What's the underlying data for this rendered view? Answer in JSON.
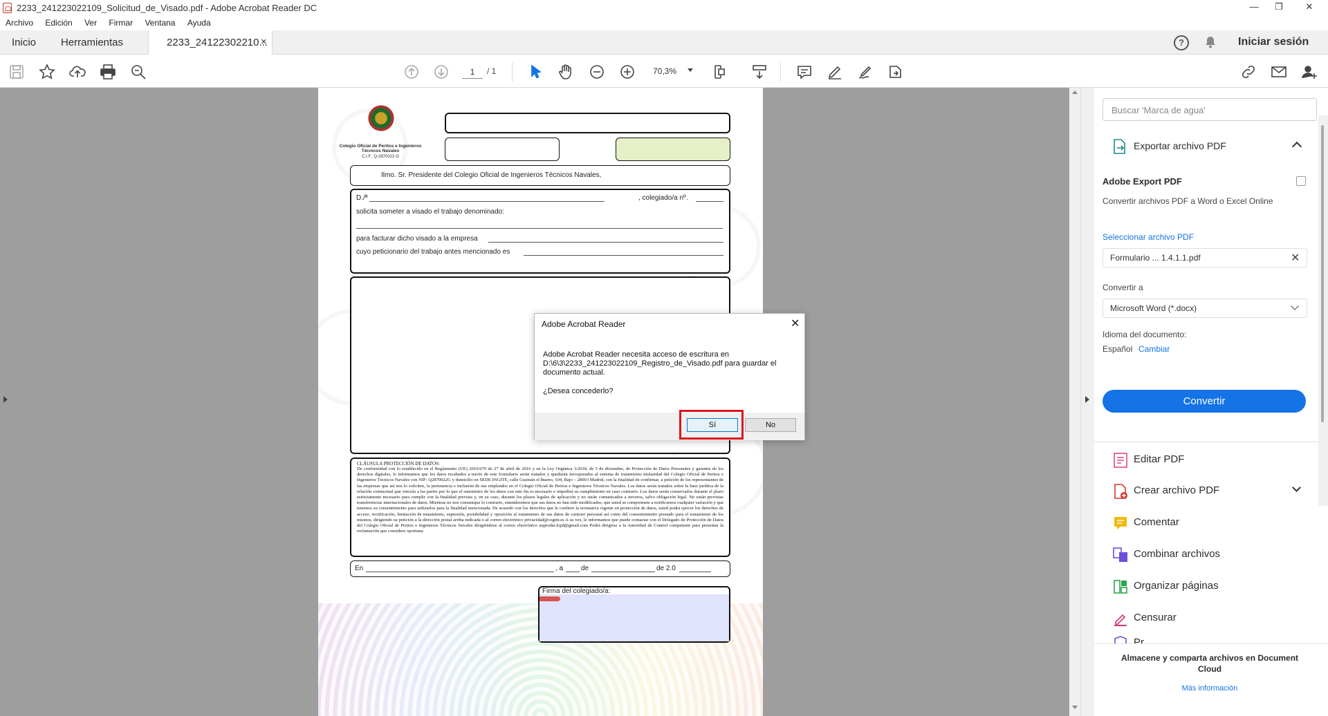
{
  "window": {
    "title": "2233_241223022109_Solicitud_de_Visado.pdf - Adobe Acrobat Reader DC",
    "controls": [
      "—",
      "❐",
      "✕"
    ]
  },
  "menu": [
    "Archivo",
    "Edición",
    "Ver",
    "Firmar",
    "Ventana",
    "Ayuda"
  ],
  "tabs": {
    "home": "Inicio",
    "tools": "Herramientas",
    "doc": "2233_24122302210...",
    "doc_close": "×",
    "signin": "Iniciar sesión"
  },
  "toolbar": {
    "page_current": "1",
    "page_total": "/ 1",
    "zoom": "70,3%"
  },
  "form": {
    "org_name": "Colegio Oficial de Peritos e Ingenieros Técnicos Navales",
    "cif": "C.I.F.: Q-2870022-G",
    "addressee": "Ilmo. Sr. Presidente del Colegio Oficial de Ingenieros Técnicos Navales,",
    "line1_a": "D./ª",
    "line1_b": ", colegiado/a nº.",
    "line2": "solicita someter a visado el trabajo denominado:",
    "line4": "para facturar dicho visado a la empresa",
    "line5": "cuyo peticionario del trabajo antes mencionado es",
    "legal_title": "CLÁUSULA PROTECCIÓN DE DATOS:",
    "legal_text": "De conformidad con lo establecido en el Reglamento (UE) 2016/679 de 27 de abril de 2016 y en la Ley Orgánica 3/2018, de 5 de diciembre, de Protección de Datos Personales y garantía de los derechos digitales, le informamos que los datos recabados a través de este formulario serán tratados y quedarán incorporados al sistema de tratamiento titularidad del Colegio Oficial de Peritos e Ingenieros Técnicos Navales con NIF: Q2870022G y domicilio en SEDE INGITE, calle Guzmán el Bueno, 104, Bajo – 28003 Madrid, con la finalidad de confirmar, a petición de los representantes de las empresas que así nos lo soliciten, la pertenencia e inclusión de sus empleados en el Colegio Oficial de Peritos e Ingenieros Técnicos Navales. Los datos serán tratados sobre la base jurídica de la relación contractual que vincula a las partes por lo que el suministro de los datos con este fin es necesario e impedirá su cumplimiento en caso contrario. Los datos serán conservados durante el plazo estrictamente necesario para cumplir con la finalidad prevista y, en su caso, durante los plazos legales de aplicación y no serán comunicados a terceros, salvo obligación legal. No están previstas transferencias internacionales de datos. Mientras no nos comunique lo contrario, entenderemos que sus datos no han sido modificados, que usted se compromete a notificarnos cualquier variación y que tenemos su consentimiento para utilizarlos para la finalidad mencionada. De acuerdo con los derechos que le confiere la normativa vigente en protección de datos, usted podrá ejercer los derechos de acceso, rectificación, limitación de tratamiento, supresión, portabilidad y oposición al tratamiento de sus datos de carácter personal así como del consentimiento prestado para el tratamiento de los mismos, dirigiendo su petición a la dirección postal arriba indicada o al correo electrónico privacidad@cogitn.es A su vez, le informamos que puede contactar con el Delegado de Protección de Datos del Colegio Oficial de Peritos e Ingenieros Técnicos Navales dirigiéndose al correo electrónico auprodat.lopd@gmail.com Podrá dirigirse a la Autoridad de Control competente para presentar la reclamación que considere oportuna.",
    "date_en": "En",
    "date_a": ", a",
    "date_de": "de",
    "date_year": "de 2.0",
    "signature_label": "Firma del colegiado/a:"
  },
  "dialog": {
    "title": "Adobe Acrobat Reader",
    "close": "✕",
    "message": "Adobe Acrobat Reader necesita acceso de escritura en D:\\6\\3\\2233_241223022109_Registro_de_Visado.pdf para guardar el documento actual.",
    "question": "¿Desea concederlo?",
    "yes": "Sí",
    "no": "No"
  },
  "right_panel": {
    "search_placeholder": "Buscar 'Marca de agua'",
    "export_header": "Exportar archivo PDF",
    "service_title": "Adobe Export PDF",
    "service_desc": "Convertir archivos PDF a Word o Excel Online",
    "select_link": "Seleccionar archivo PDF",
    "file_name": "Formulario ... 1.4.1.1.pdf",
    "convert_to_label": "Convertir a",
    "format": "Microsoft Word (*.docx)",
    "doc_lang_label": "Idioma del documento:",
    "doc_lang": "Español",
    "change_link": "Cambiar",
    "convert_button": "Convertir",
    "tools": [
      "Editar PDF",
      "Crear archivo PDF",
      "Comentar",
      "Combinar archivos",
      "Organizar páginas",
      "Censurar",
      "Pr..."
    ],
    "cloud_text": "Almacene y comparta archivos en Document Cloud",
    "more_info": "Más información"
  },
  "colors": {
    "accent": "#1473e6",
    "highlight_box": "#e0141e",
    "doc_background": "#9e9e9e"
  }
}
